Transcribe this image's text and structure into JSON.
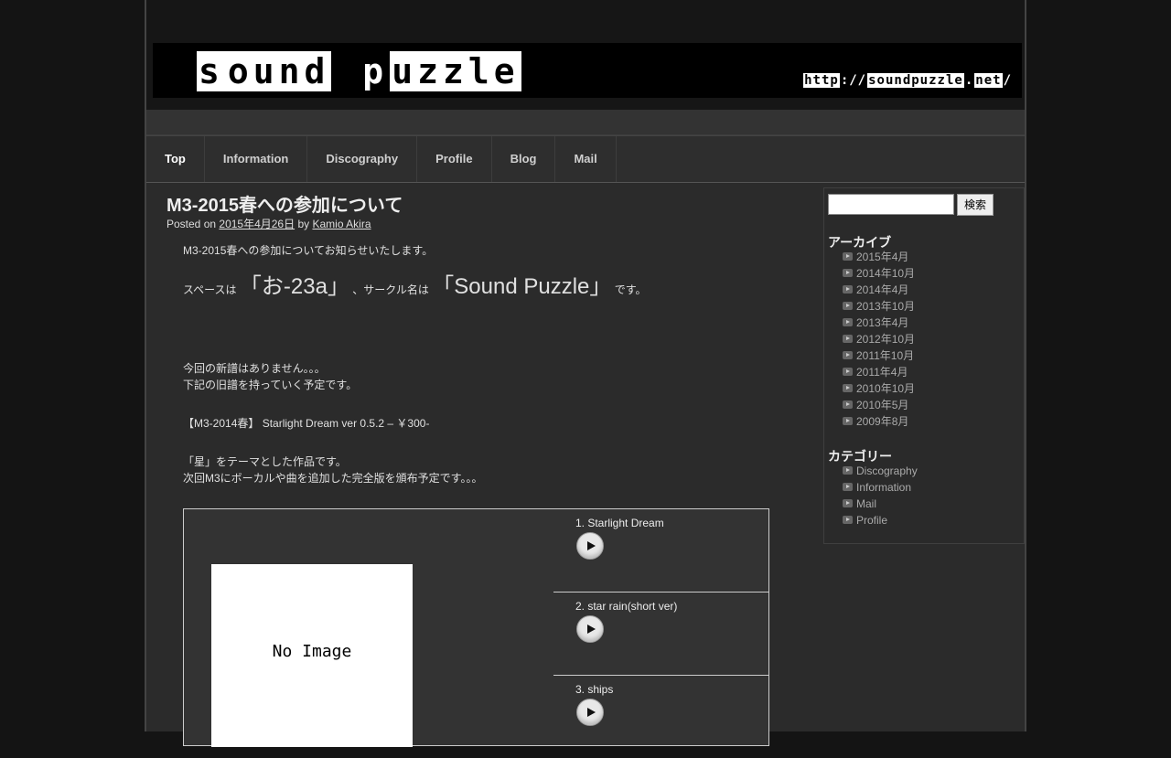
{
  "header": {
    "logo_parts": [
      "s",
      "ound",
      " ",
      "p",
      "uzzle"
    ],
    "url_parts": [
      "http",
      "://",
      "soundpuzzle",
      ".",
      "net",
      "/"
    ]
  },
  "nav": {
    "items": [
      {
        "label": "Top",
        "active": true
      },
      {
        "label": "Information"
      },
      {
        "label": "Discography"
      },
      {
        "label": "Profile"
      },
      {
        "label": "Blog"
      },
      {
        "label": "Mail"
      }
    ]
  },
  "post": {
    "title": "M3-2015春への参加について",
    "meta": {
      "posted_on": "Posted on",
      "date": "2015年4月26日",
      "by": "by",
      "author": "Kamio Akira"
    },
    "intro": "M3-2015春への参加についてお知らせいたします。",
    "space_line": {
      "space_label": "スペースは",
      "space_value": "「お-23a」",
      "circle_label": "、サークル名は",
      "circle_value": "「Sound Puzzle」",
      "suffix": "です。"
    },
    "no_new_line1": "今回の新譜はありません。。。",
    "no_new_line2": "下記の旧譜を持っていく予定です。",
    "release": "【M3-2014春】 Starlight Dream ver 0.5.2 – ￥300-",
    "desc_line1": "「星」をテーマとした作品です。",
    "desc_line2": "次回M3にボーカルや曲を追加した完全版を頒布予定です。。。"
  },
  "player": {
    "cover_text": "No Image",
    "tracks": [
      {
        "title": "1. Starlight Dream"
      },
      {
        "title": "2. star rain(short ver)"
      },
      {
        "title": "3. ships"
      }
    ]
  },
  "sidebar": {
    "search_button": "検索",
    "archive_title": "アーカイブ",
    "archives": [
      "2015年4月",
      "2014年10月",
      "2014年4月",
      "2013年10月",
      "2013年4月",
      "2012年10月",
      "2011年10月",
      "2011年4月",
      "2010年10月",
      "2010年5月",
      "2009年8月"
    ],
    "category_title": "カテゴリー",
    "categories": [
      "Discography",
      "Information",
      "Mail",
      "Profile"
    ]
  }
}
